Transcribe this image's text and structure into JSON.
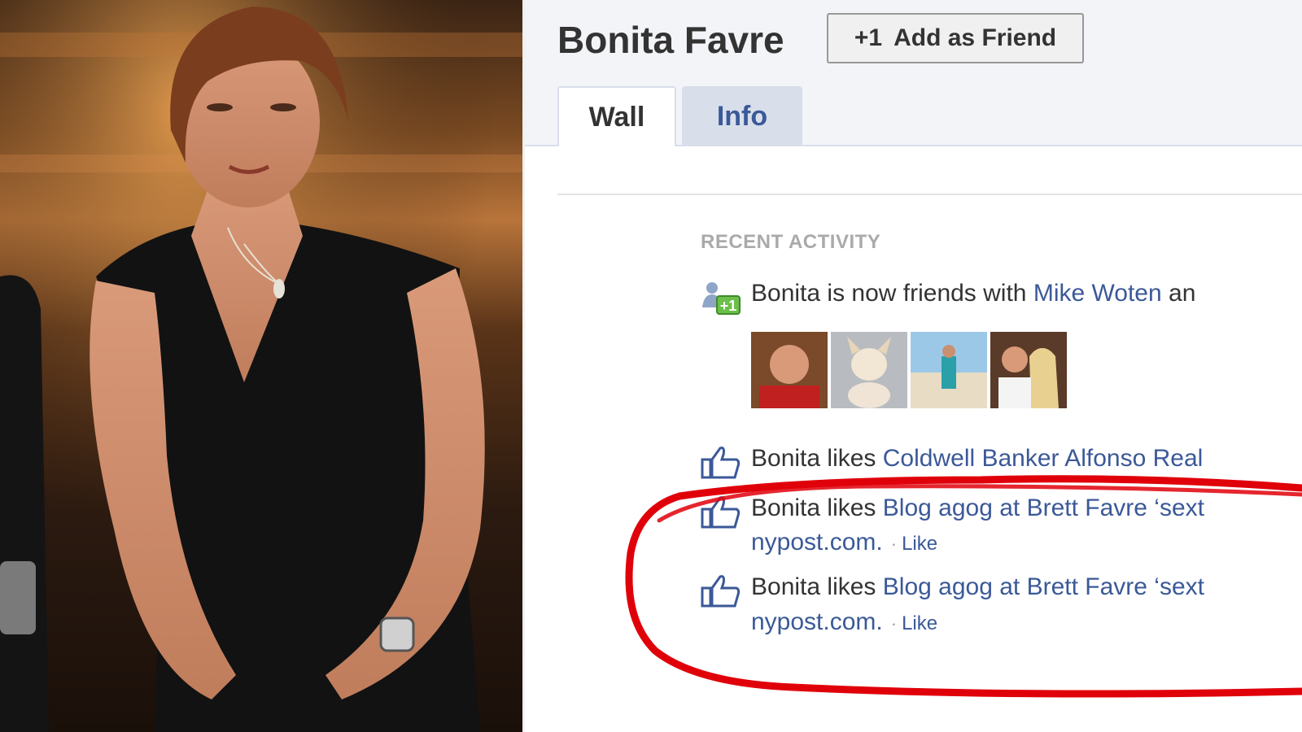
{
  "profile": {
    "name": "Bonita Favre",
    "add_friend_icon": "+1",
    "add_friend_label": "Add as Friend"
  },
  "tabs": [
    {
      "label": "Wall"
    },
    {
      "label": "Info"
    }
  ],
  "recent_activity": {
    "title": "RECENT ACTIVITY",
    "friends_row": {
      "icon": "add-friend-icon",
      "prefix": "Bonita is now friends with",
      "link": "Mike Woten",
      "suffix": "an"
    },
    "likes": [
      {
        "prefix": "Bonita likes",
        "link": "Coldwell Banker Alfonso Real"
      },
      {
        "prefix": "Bonita likes",
        "link": "Blog agog at Brett Favre ‘sext",
        "source": "nypost.com.",
        "action": "Like"
      },
      {
        "prefix": "Bonita likes",
        "link": "Blog agog at Brett Favre ‘sext",
        "source": "nypost.com.",
        "action": "Like"
      }
    ]
  },
  "colors": {
    "link": "#3b5998",
    "highlight_circle": "#e0000a",
    "header_bg": "#f2f4f8"
  }
}
